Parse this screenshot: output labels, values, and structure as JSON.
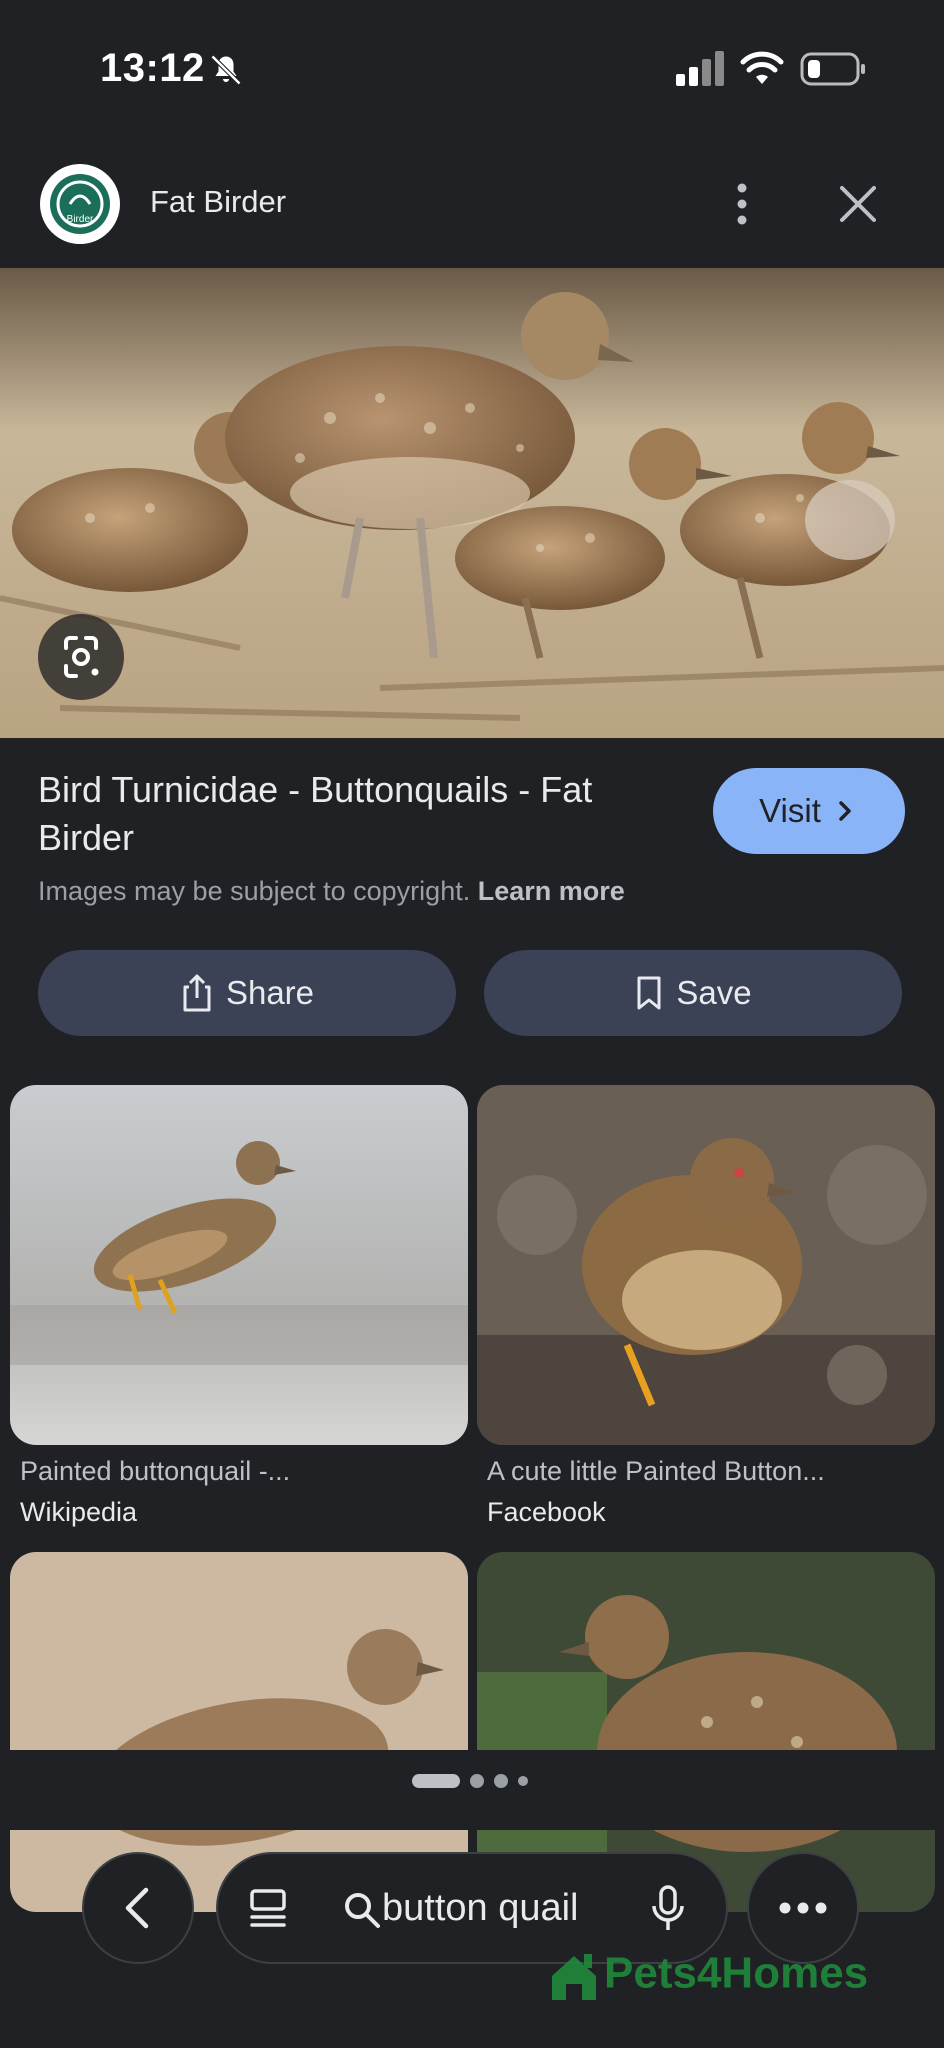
{
  "status_bar": {
    "time": "13:12"
  },
  "header": {
    "site_name": "Fat Birder",
    "logo_text": "Birder"
  },
  "result": {
    "title": "Bird Turnicidae - Buttonquails - Fat Birder",
    "visit_label": "Visit",
    "copyright_text": "Images may be subject to copyright.",
    "learn_more": "Learn more"
  },
  "actions": {
    "share_label": "Share",
    "save_label": "Save"
  },
  "related": [
    {
      "title": "Painted buttonquail -...",
      "source": "Wikipedia"
    },
    {
      "title": "A cute little Painted Button...",
      "source": "Facebook"
    },
    {
      "title": "",
      "source": ""
    },
    {
      "title": "",
      "source": ""
    }
  ],
  "pager": {
    "count": 4,
    "active": 0
  },
  "bottom_bar": {
    "query": "button quail"
  },
  "watermark": "Pets4Homes",
  "colors": {
    "background": "#202124",
    "visit_button": "#8ab4f8",
    "action_button": "#3c4256",
    "watermark": "#1f8a3c"
  }
}
